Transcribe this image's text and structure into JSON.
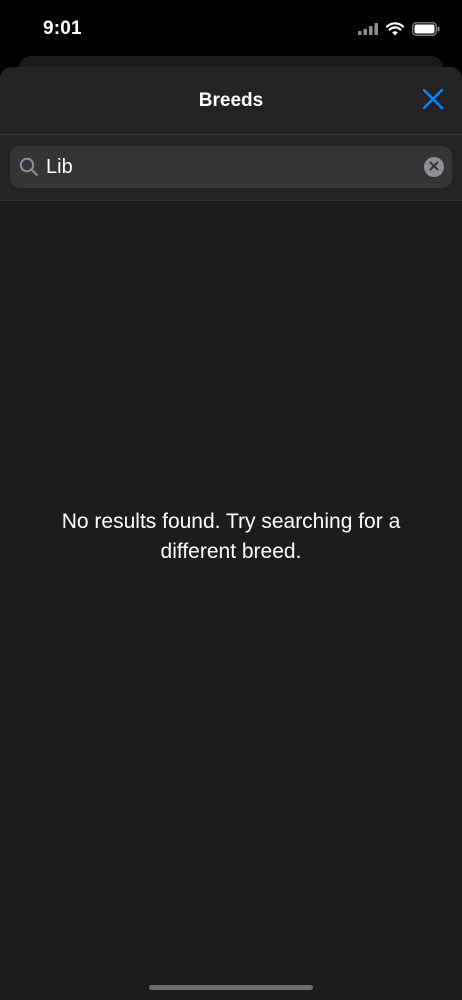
{
  "status_bar": {
    "time": "9:01",
    "icons": [
      "signal-icon",
      "wifi-icon",
      "battery-icon"
    ]
  },
  "nav": {
    "title": "Breeds",
    "close_icon": "close-icon",
    "accent_color": "#0a84ff"
  },
  "search": {
    "value": "Lib",
    "icon": "search-icon",
    "clear_icon": "clear-icon"
  },
  "results": {
    "empty_message": "No results found. Try searching for a different breed."
  }
}
